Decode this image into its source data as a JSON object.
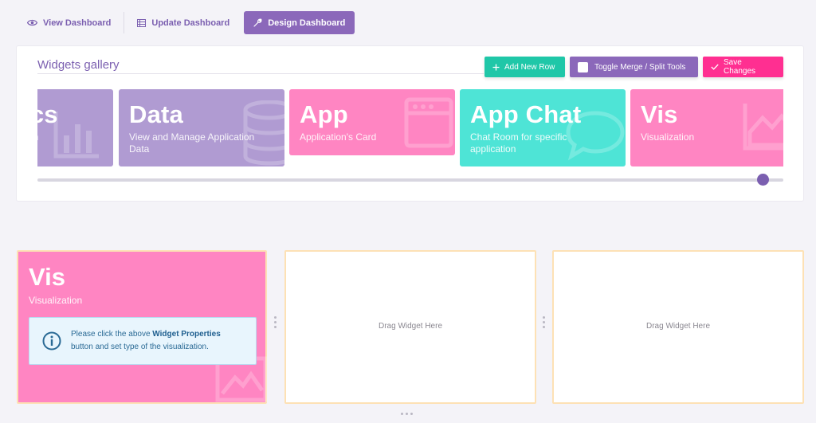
{
  "tabs": {
    "view": "View Dashboard",
    "update": "Update Dashboard",
    "design": "Design Dashboard"
  },
  "gallery": {
    "title": "Widgets gallery",
    "add_row": "Add New Row",
    "toggle": "Toggle Merge / Split Tools",
    "save": "Save Changes",
    "cards": [
      {
        "title": "ics",
        "subtitle": "thin"
      },
      {
        "title": "Data",
        "subtitle": "View and Manage Application Data"
      },
      {
        "title": "App",
        "subtitle": "Application's Card"
      },
      {
        "title": "App Chat",
        "subtitle": "Chat Room for specific application"
      },
      {
        "title": "Vis",
        "subtitle": "Visualization"
      }
    ],
    "scroll_position": 0.97
  },
  "row": {
    "widget": {
      "title": "Vis",
      "subtitle": "Visualization",
      "info_pre": "Please click the above ",
      "info_bold": "Widget Properties",
      "info_post": "button and set type of the visualization."
    },
    "placeholder_1": "Drag Widget Here",
    "placeholder_2": "Drag Widget Here"
  },
  "colors": {
    "accent_purple": "#8b68ba",
    "teal": "#1fc7a8",
    "pink": "#ff2f91",
    "card_pink": "#ff85c2",
    "card_purple": "#b09bd2",
    "card_teal": "#4ee4d6"
  }
}
